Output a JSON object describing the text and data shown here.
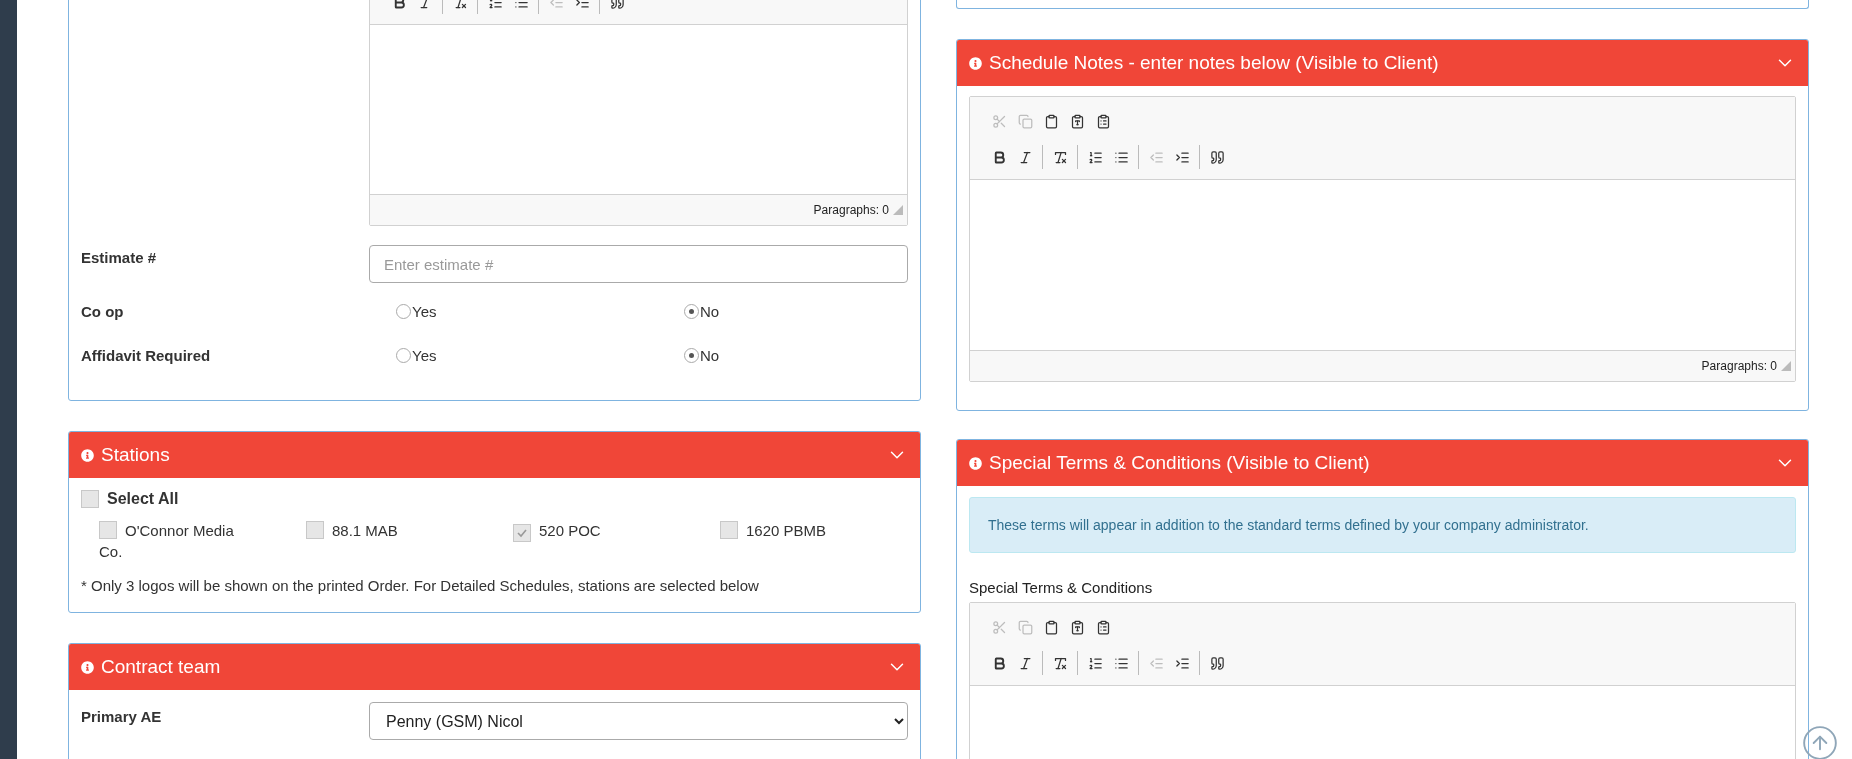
{
  "left_column": {
    "details_panel": {
      "editor": {
        "toolbar": [
          [
            [
              {
                "kind": "bold",
                "disabled": false
              },
              {
                "kind": "italic",
                "disabled": false
              }
            ],
            [
              {
                "kind": "remove-format",
                "disabled": false
              }
            ],
            [
              {
                "kind": "numbered-list",
                "disabled": false
              },
              {
                "kind": "bulleted-list",
                "disabled": false
              }
            ],
            [
              {
                "kind": "outdent",
                "disabled": true
              },
              {
                "kind": "indent",
                "disabled": false
              }
            ],
            [
              {
                "kind": "blockquote",
                "disabled": false
              }
            ]
          ]
        ],
        "status": "Paragraphs: 0"
      },
      "estimate": {
        "label": "Estimate #",
        "placeholder": "Enter estimate #"
      },
      "radio_rows": [
        {
          "label": "Co op",
          "options": [
            {
              "label": "Yes",
              "selected": false
            },
            {
              "label": "No",
              "selected": true
            }
          ]
        },
        {
          "label": "Affidavit Required",
          "options": [
            {
              "label": "Yes",
              "selected": false
            },
            {
              "label": "No",
              "selected": true
            }
          ]
        }
      ]
    },
    "stations_panel": {
      "title": "Stations",
      "select_all": {
        "label": "Select All",
        "checked": false
      },
      "stations": [
        {
          "label": "O'Connor Media Co.",
          "checked": false
        },
        {
          "label": "88.1 MAB",
          "checked": false
        },
        {
          "label": "520 POC",
          "checked": true
        },
        {
          "label": "1620 PBMB",
          "checked": false
        }
      ],
      "note": "* Only 3 logos will be shown on the printed Order. For Detailed Schedules, stations are selected below"
    },
    "contract_panel": {
      "title": "Contract team",
      "primary_ae": {
        "label": "Primary AE",
        "value": "Penny (GSM) Nicol"
      }
    }
  },
  "right_column": {
    "schedule_notes_panel": {
      "title": "Schedule Notes - enter notes below (Visible to Client)",
      "editor": {
        "toolbar": [
          [
            [
              {
                "kind": "cut",
                "disabled": true
              },
              {
                "kind": "copy",
                "disabled": true
              },
              {
                "kind": "paste",
                "disabled": false
              },
              {
                "kind": "paste-text",
                "disabled": false
              },
              {
                "kind": "paste-word",
                "disabled": false
              }
            ]
          ],
          [
            [
              {
                "kind": "bold",
                "disabled": false
              },
              {
                "kind": "italic",
                "disabled": false
              }
            ],
            [
              {
                "kind": "remove-format",
                "disabled": false
              }
            ],
            [
              {
                "kind": "numbered-list",
                "disabled": false
              },
              {
                "kind": "bulleted-list",
                "disabled": false
              }
            ],
            [
              {
                "kind": "outdent",
                "disabled": true
              },
              {
                "kind": "indent",
                "disabled": false
              }
            ],
            [
              {
                "kind": "blockquote",
                "disabled": false
              }
            ]
          ]
        ],
        "status": "Paragraphs: 0"
      }
    },
    "terms_panel": {
      "title": "Special Terms & Conditions (Visible to Client)",
      "alert": "These terms will appear in addition to the standard terms defined by your company administrator.",
      "label": "Special Terms & Conditions",
      "editor": {
        "toolbar": [
          [
            [
              {
                "kind": "cut",
                "disabled": true
              },
              {
                "kind": "copy",
                "disabled": true
              },
              {
                "kind": "paste",
                "disabled": false
              },
              {
                "kind": "paste-text",
                "disabled": false
              },
              {
                "kind": "paste-word",
                "disabled": false
              }
            ]
          ],
          [
            [
              {
                "kind": "bold",
                "disabled": false
              },
              {
                "kind": "italic",
                "disabled": false
              }
            ],
            [
              {
                "kind": "remove-format",
                "disabled": false
              }
            ],
            [
              {
                "kind": "numbered-list",
                "disabled": false
              },
              {
                "kind": "bulleted-list",
                "disabled": false
              }
            ],
            [
              {
                "kind": "outdent",
                "disabled": true
              },
              {
                "kind": "indent",
                "disabled": false
              }
            ],
            [
              {
                "kind": "blockquote",
                "disabled": false
              }
            ]
          ]
        ]
      }
    }
  }
}
